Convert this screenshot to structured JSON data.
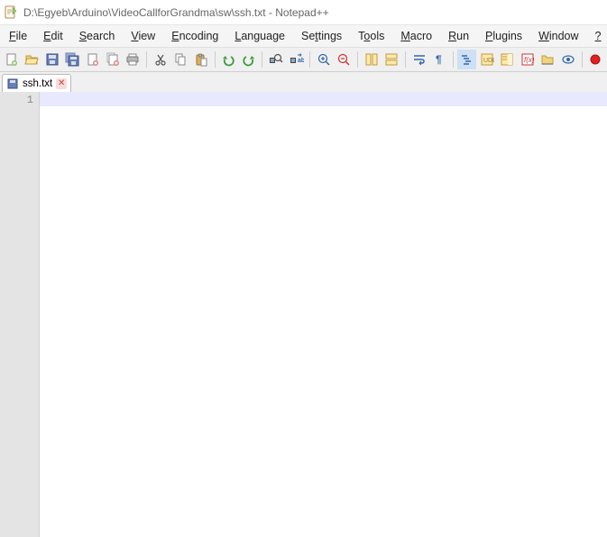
{
  "title": {
    "path": "D:\\Egyeb\\Arduino\\VideoCallforGrandma\\sw\\ssh.txt",
    "app": "Notepad++"
  },
  "menu": {
    "file": "File",
    "edit": "Edit",
    "search": "Search",
    "view": "View",
    "encoding": "Encoding",
    "language": "Language",
    "settings": "Settings",
    "tools": "Tools",
    "macro": "Macro",
    "run": "Run",
    "plugins": "Plugins",
    "window": "Window",
    "help": "?"
  },
  "tabs": [
    {
      "label": "ssh.txt",
      "active": true
    }
  ],
  "editor": {
    "first_line_number": "1",
    "content": ""
  },
  "toolbar_icons": [
    "new-file",
    "open-file",
    "save-file",
    "save-all",
    "close-file",
    "close-all",
    "print",
    "cut",
    "copy",
    "paste",
    "undo",
    "redo",
    "find",
    "replace",
    "zoom-in",
    "zoom-out",
    "sync-v",
    "sync-h",
    "word-wrap",
    "show-all-chars",
    "indent-guide",
    "udl",
    "doc-map",
    "func-list",
    "folder-as-workspace",
    "monitor",
    "record-macro"
  ]
}
